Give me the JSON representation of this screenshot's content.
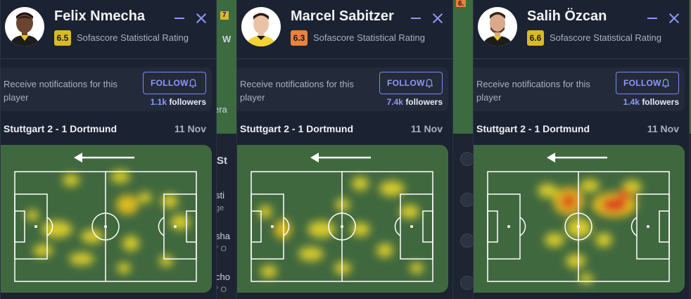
{
  "background": {
    "fragments": [
      "7",
      "W",
      "era",
      "St",
      "sti",
      "ge",
      "sha",
      "° O",
      "cho",
      "° O",
      "6."
    ]
  },
  "cards": [
    {
      "name": "Felix Nmecha",
      "rating": "6.5",
      "rating_color": "#d9b92c",
      "rating_label": "Sofascore Statistical Rating",
      "notify_text": "Receive notifications for this player",
      "follow_label": "FOLLOW",
      "followers_count": "1.1k",
      "followers_label": "followers",
      "match": "Stuttgart 2 - 1 Dortmund",
      "date": "11 Nov",
      "icons": {
        "minimize": "minimize-icon",
        "close": "close-icon",
        "bell": "bell-icon",
        "direction": "arrow-left-icon"
      }
    },
    {
      "name": "Marcel Sabitzer",
      "rating": "6.3",
      "rating_color": "#e8823c",
      "rating_label": "Sofascore Statistical Rating",
      "notify_text": "Receive notifications for this player",
      "follow_label": "FOLLOW",
      "followers_count": "7.4k",
      "followers_label": "followers",
      "match": "Stuttgart 2 - 1 Dortmund",
      "date": "11 Nov",
      "icons": {
        "minimize": "minimize-icon",
        "close": "close-icon",
        "bell": "bell-icon",
        "direction": "arrow-left-icon"
      }
    },
    {
      "name": "Salih Özcan",
      "rating": "6.6",
      "rating_color": "#d9b92c",
      "rating_label": "Sofascore Statistical Rating",
      "notify_text": "Receive notifications for this player",
      "follow_label": "FOLLOW",
      "followers_count": "1.4k",
      "followers_label": "followers",
      "match": "Stuttgart 2 - 1 Dortmund",
      "date": "11 Nov",
      "icons": {
        "minimize": "minimize-icon",
        "close": "close-icon",
        "bell": "bell-icon",
        "direction": "arrow-left-icon"
      }
    }
  ],
  "colors": {
    "accent": "#8e98f8",
    "pitch": "#40683f",
    "heat_low": "#f2dc1e",
    "heat_high": "#e8321e"
  }
}
